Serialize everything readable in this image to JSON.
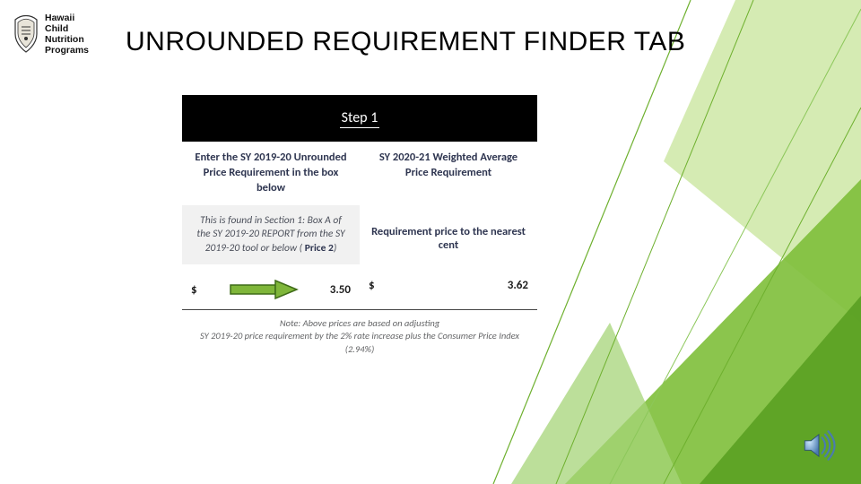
{
  "logo": {
    "line1": "Hawaii",
    "line2": "Child",
    "line3": "Nutrition",
    "line4": "Programs"
  },
  "title": "UNROUNDED REQUIREMENT FINDER TAB",
  "step_label": "Step 1",
  "col1_header": "Enter the SY 2019-20 Unrounded Price Requirement in the box below",
  "col2_header": "SY 2020-21 Weighted Average Price Requirement",
  "col1_sub_prefix": "This is found in Section 1: Box A of the SY 2019-20 REPORT from the SY 2019-20 tool or below ( ",
  "col1_sub_price2": "Price 2",
  "col1_sub_suffix": ")",
  "col2_sub": "Requirement price to the nearest cent",
  "col1_currency": "$",
  "col1_value": "3.50",
  "col2_currency": "$",
  "col2_value": "3.62",
  "note_line1": "Note: Above prices are based on adjusting",
  "note_line2_prefix": "SY 2019-20 price requirement by the 2% rate increase plus the Consumer Price Index (",
  "note_cpi": "2.94%",
  "note_line2_suffix": ")"
}
